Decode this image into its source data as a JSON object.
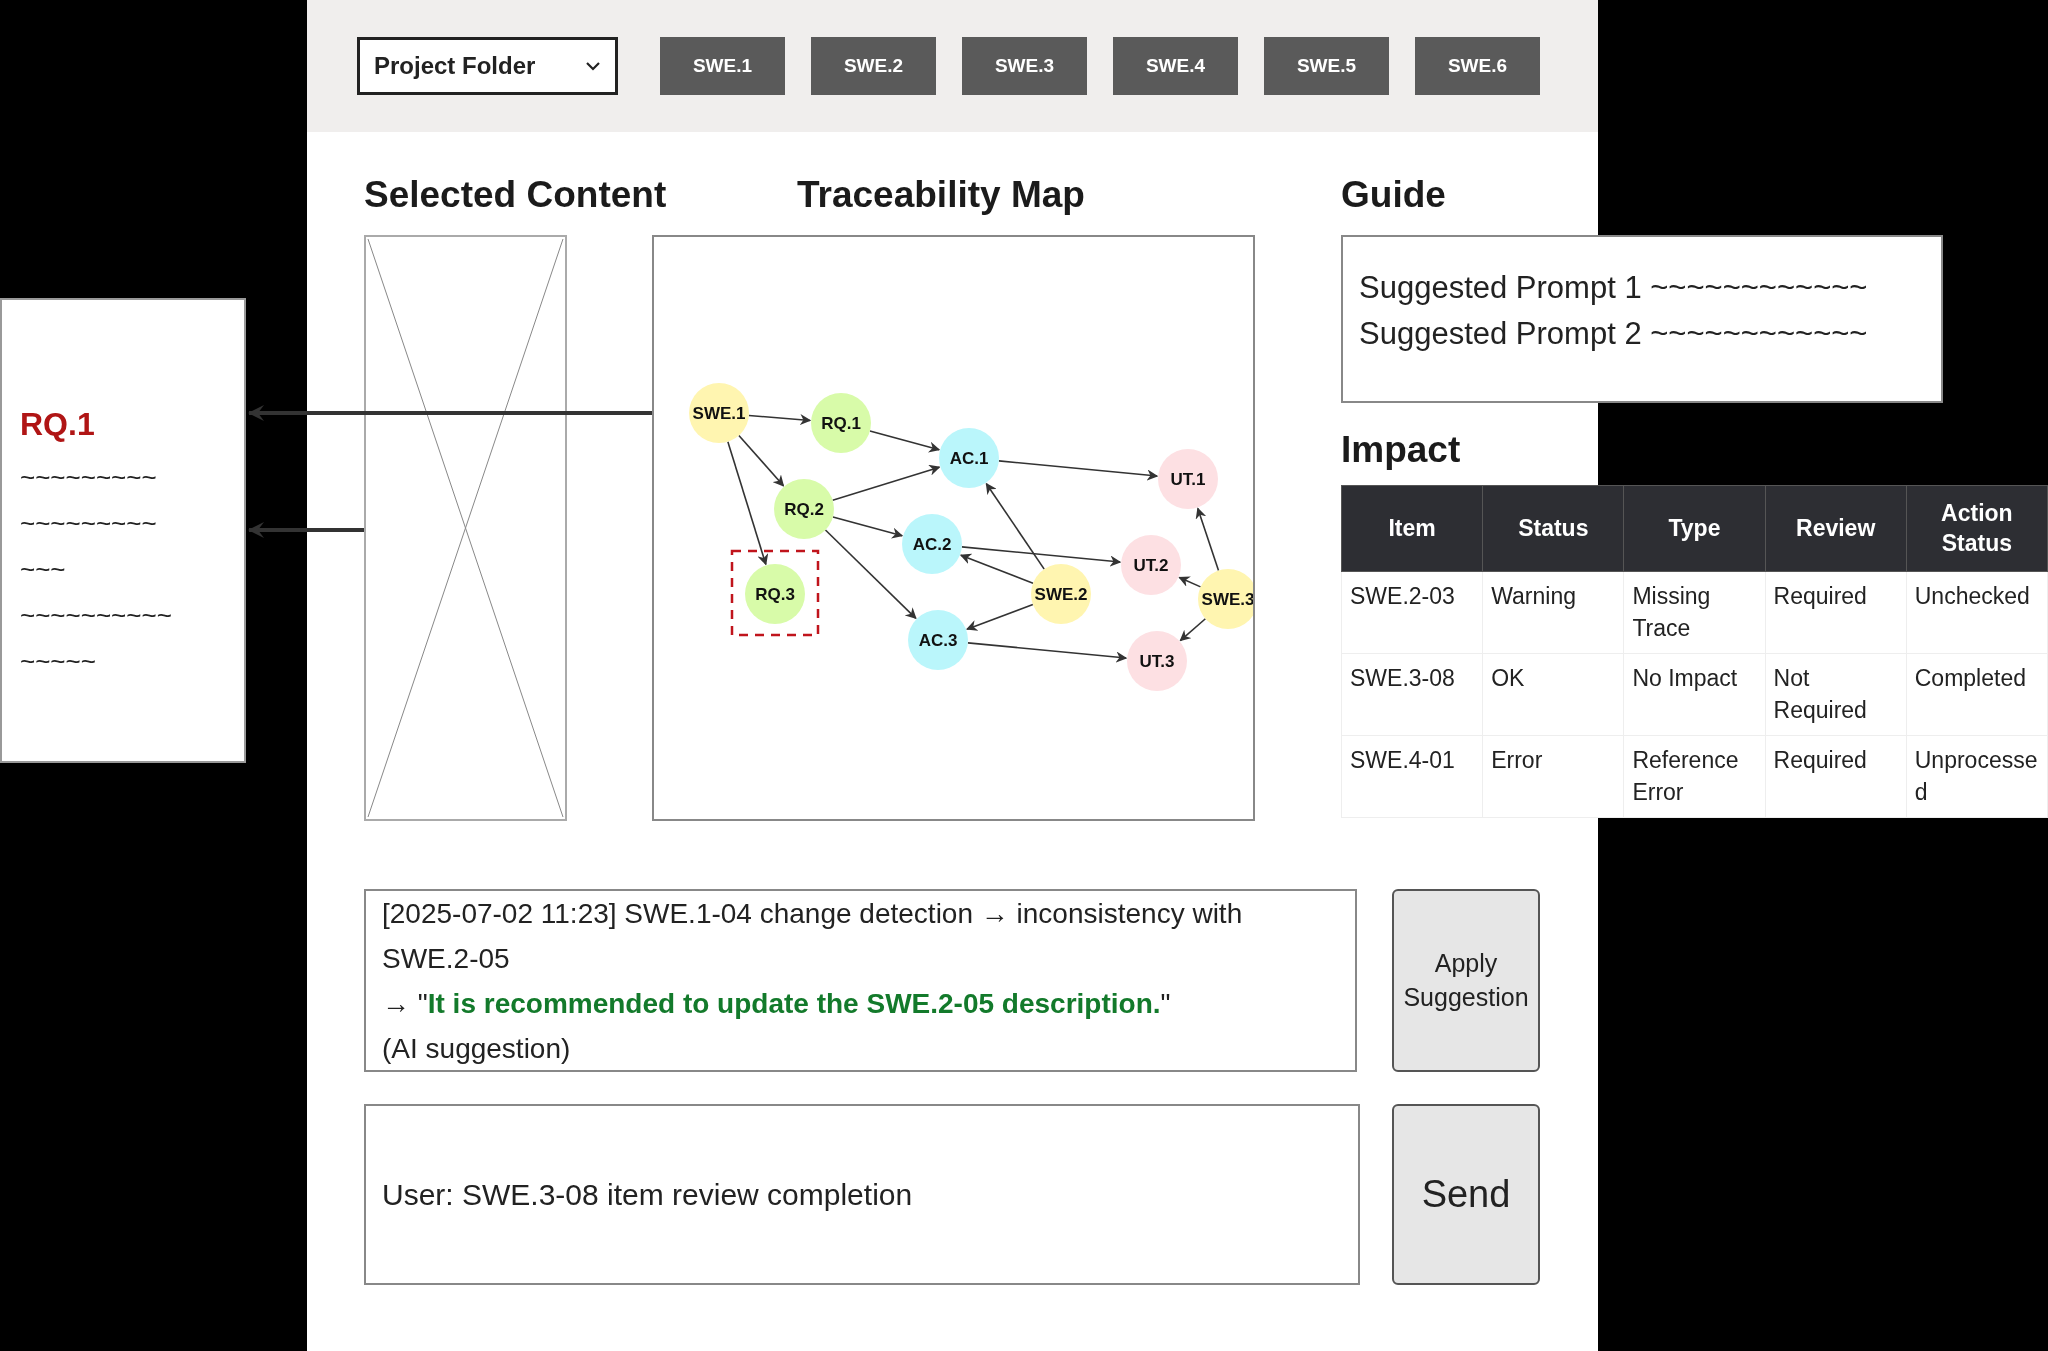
{
  "toolbar": {
    "folder_select": {
      "value": "Project Folder"
    },
    "phase_buttons": [
      "SWE.1",
      "SWE.2",
      "SWE.3",
      "SWE.4",
      "SWE.5",
      "SWE.6"
    ]
  },
  "detail_panel": {
    "title": "RQ.1",
    "lines": [
      "~~~~~~~~~",
      "~~~~~~~~~",
      "~~~",
      "~~~~~~~~~~",
      "~~~~~"
    ]
  },
  "selected_content": {
    "title": "Selected Content"
  },
  "traceability_map": {
    "title": "Traceability Map",
    "nodes": [
      {
        "label": "SWE.1",
        "color": "#fff5b0",
        "highlighted": false
      },
      {
        "label": "RQ.1",
        "color": "#d8fba9",
        "highlighted": false
      },
      {
        "label": "RQ.2",
        "color": "#d8fba9",
        "highlighted": false
      },
      {
        "label": "RQ.3",
        "color": "#d8fba9",
        "highlighted": true
      },
      {
        "label": "AC.1",
        "color": "#baf6fb",
        "highlighted": false
      },
      {
        "label": "AC.2",
        "color": "#baf6fb",
        "highlighted": false
      },
      {
        "label": "AC.3",
        "color": "#baf6fb",
        "highlighted": false
      },
      {
        "label": "SWE.2",
        "color": "#fff5b0",
        "highlighted": false
      },
      {
        "label": "SWE.3",
        "color": "#fff5b0",
        "highlighted": false
      },
      {
        "label": "UT.1",
        "color": "#fde0e3",
        "highlighted": false
      },
      {
        "label": "UT.2",
        "color": "#fde0e3",
        "highlighted": false
      },
      {
        "label": "UT.3",
        "color": "#fde0e3",
        "highlighted": false
      }
    ]
  },
  "guide": {
    "title": "Guide",
    "prompts": [
      "Suggested Prompt 1 ~~~~~~~~~~~~",
      "Suggested Prompt 2 ~~~~~~~~~~~~"
    ]
  },
  "impact": {
    "title": "Impact",
    "columns": [
      "Item",
      "Status",
      "Type",
      "Review",
      "Action Status"
    ],
    "rows": [
      [
        "SWE.2-03",
        "Warning",
        "Missing Trace",
        "Required",
        "Unchecked"
      ],
      [
        "SWE.3-08",
        "OK",
        "No Impact",
        "Not Required",
        "Completed"
      ],
      [
        "SWE.4-01",
        "Error",
        "Reference Error",
        "Required",
        "Unprocessed"
      ]
    ]
  },
  "log": {
    "lines": [
      "[2025-07-02 11:23] SWE.1-04 change detection → inconsistency with SWE.2-05",
      "→ \"**It is recommended to update the SWE.2-05 description.**\"",
      "(AI suggestion)"
    ],
    "button": "Apply Suggestion"
  },
  "message": {
    "value": "User: SWE.3-08 item review completion",
    "button": "Send"
  }
}
